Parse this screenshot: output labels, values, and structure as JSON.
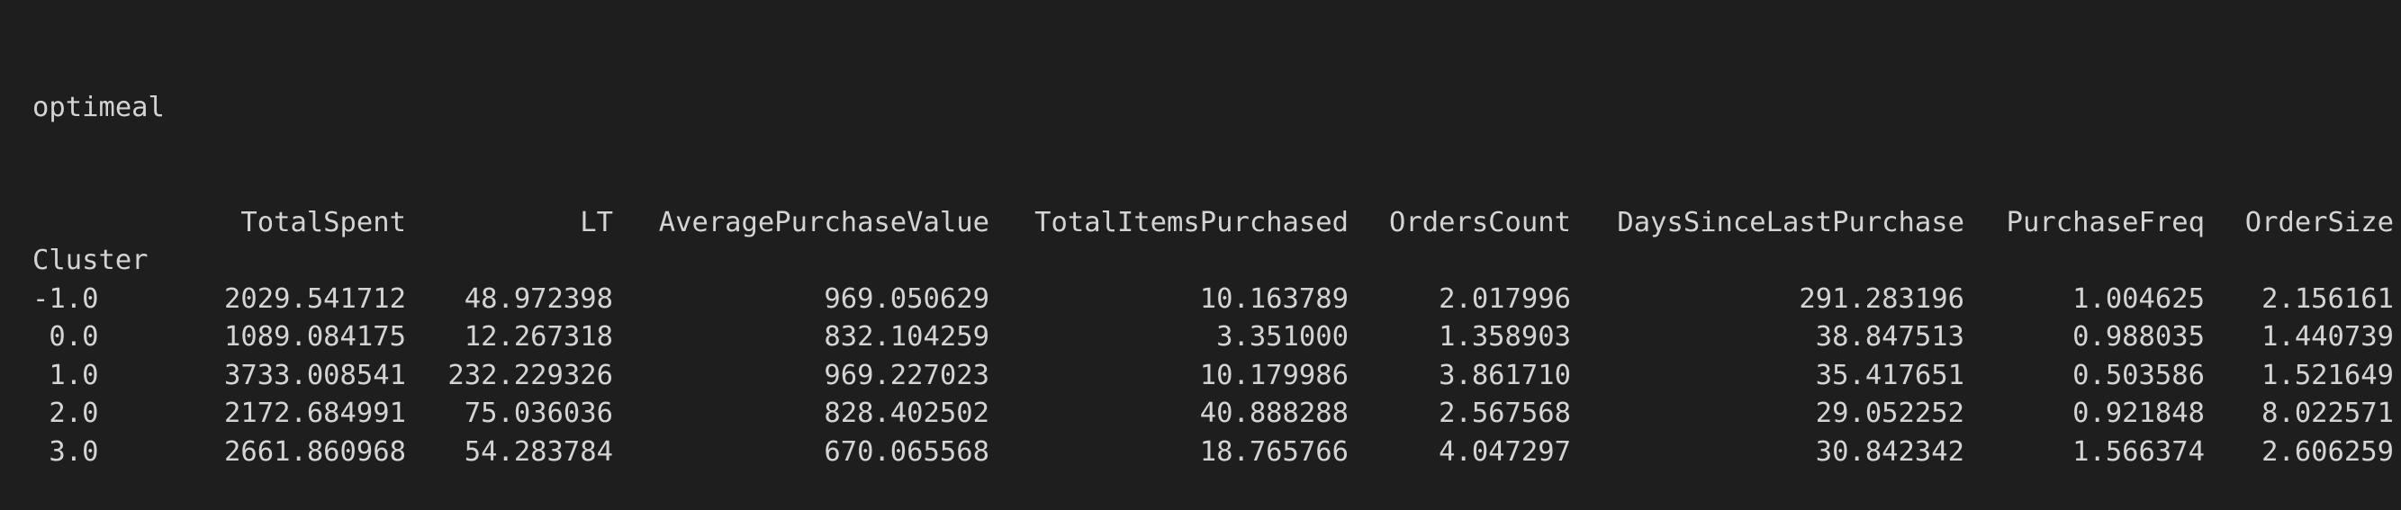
{
  "output": {
    "columns_name": "optimeal",
    "index_name": "Cluster",
    "columns": [
      "TotalSpent",
      "LT",
      "AveragePurchaseValue",
      "TotalItemsPurchased",
      "OrdersCount",
      "DaysSinceLastPurchase",
      "PurchaseFreq",
      "OrderSize"
    ],
    "rows": [
      {
        "index": "-1.0",
        "values": [
          "2029.541712",
          "48.972398",
          "969.050629",
          "10.163789",
          "2.017996",
          "291.283196",
          "1.004625",
          "2.156161"
        ]
      },
      {
        "index": " 0.0",
        "values": [
          "1089.084175",
          "12.267318",
          "832.104259",
          "3.351000",
          "1.358903",
          "38.847513",
          "0.988035",
          "1.440739"
        ]
      },
      {
        "index": " 1.0",
        "values": [
          "3733.008541",
          "232.229326",
          "969.227023",
          "10.179986",
          "3.861710",
          "35.417651",
          "0.503586",
          "1.521649"
        ]
      },
      {
        "index": " 2.0",
        "values": [
          "2172.684991",
          "75.036036",
          "828.402502",
          "40.888288",
          "2.567568",
          "29.052252",
          "0.921848",
          "8.022571"
        ]
      },
      {
        "index": " 3.0",
        "values": [
          "2661.860968",
          "54.283784",
          "670.065568",
          "18.765766",
          "4.047297",
          "30.842342",
          "1.566374",
          "2.606259"
        ]
      }
    ]
  },
  "colors": {
    "background": "#1e1e1e",
    "text": "#d4d4d4"
  }
}
